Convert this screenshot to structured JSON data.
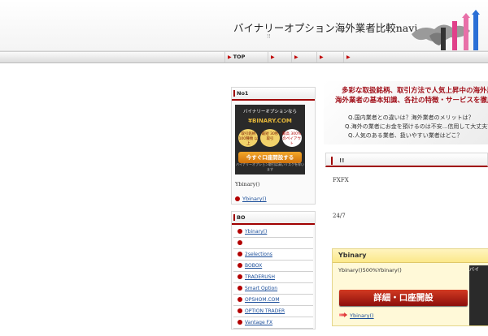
{
  "header": {
    "title": "バイナリーオプション海外業者比較navi",
    "subtitle": "!!"
  },
  "nav": {
    "items": [
      {
        "label": "TOP"
      },
      {
        "label": ""
      },
      {
        "label": ""
      },
      {
        "label": ""
      },
      {
        "label": ""
      }
    ]
  },
  "sidebar": {
    "box1": {
      "heading": "No1",
      "banner": {
        "top_text": "バイナリーオプションなら",
        "brand": "¥BINARY.COM",
        "badge1": "取引銘柄 100種類 以上",
        "badge2": "最短 30秒 取引",
        "badge3": "最高 300% のペイアウト",
        "button": "今すぐ口座開設する",
        "note": "バイナリーオプション取引は高いリスクを伴います"
      },
      "text": "Ybinary()",
      "link": "Ybinary()"
    },
    "box2": {
      "heading": "BO",
      "items": [
        "Ybinary()",
        "",
        "2selections",
        "BOBOX",
        "TRADERUSH",
        "Smart Option",
        "OPSHOM.COM",
        "OPTION TRADER",
        "Vantage FX"
      ]
    }
  },
  "main": {
    "hero": {
      "line1": "多彩な取扱銘柄、取引方法で人気上昇中の海外業",
      "line2": "海外業者の基本知識、各社の特徴・サービスを徹底比",
      "q1": "Q.国内業者との違いは？海外業者のメリットは？",
      "q2": "Q.海外の業者にお金を預けるのは不安...信用して大丈夫？",
      "q3": "Q.人気のある業者、扱いやすい業者はどこ？"
    },
    "section_heading": "!!",
    "para1": "FXFX",
    "para2": "24/7",
    "card": {
      "heading": "Ybinary",
      "text": "Ybinary()500%Ybinary()",
      "button": "詳細・口座開設",
      "link": "Ybinary()",
      "side_banner": "バイ"
    }
  },
  "colors": {
    "accent_red": "#a00000",
    "link_blue": "#1a4d99",
    "hero_red": "#a0101a"
  }
}
